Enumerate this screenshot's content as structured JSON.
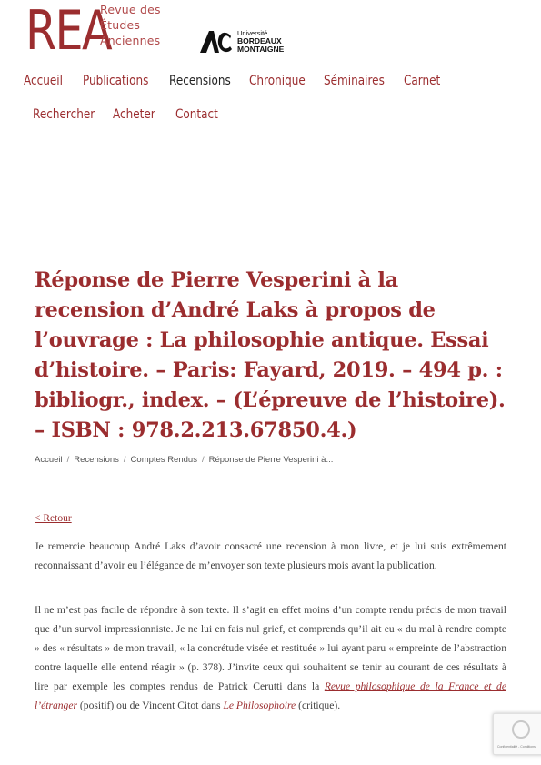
{
  "header": {
    "logo": {
      "main": "REA",
      "line1": "Revue des",
      "line2": "Études",
      "line3": "Anciennes"
    },
    "university": {
      "line1": "Université",
      "line2": "BORDEAUX",
      "line3": "MONTAIGNE"
    }
  },
  "nav": {
    "row1": [
      "Accueil",
      "Publications",
      "Recensions",
      "Chronique",
      "Séminaires",
      "Carnet"
    ],
    "row2": [
      "Rechercher",
      "Acheter",
      "Contact"
    ],
    "active": "Recensions"
  },
  "article": {
    "title": "Réponse de Pierre Vesperini à la recension d’André Laks à propos de l’ouvrage : La philosophie antique. Essai d’histoire. – Paris: Fayard, 2019. – 494 p. : bibliogr., index. – (L’épreuve de l’histoire). – ISBN : 978.2.213.67850.4.)",
    "breadcrumb": [
      "Accueil",
      "Recensions",
      "Comptes Rendus",
      "Réponse de Pierre Vesperini à..."
    ],
    "back": "< Retour",
    "p1": "Je remercie beaucoup André Laks d’avoir consacré une recension à mon livre, et je lui suis extrêmement reconnaissant d’avoir eu l’élégance de m’envoyer son texte plusieurs mois avant la publication.",
    "p2_a": "Il ne m’est pas facile de répondre à son texte. Il s’agit en effet moins d’un compte rendu précis de mon travail que d’un survol impressionniste. Je ne lui en fais nul grief, et comprends qu’il ait eu « du mal à rendre compte » des « résultats » de mon travail, « la concrétude visée et restituée » lui ayant paru « empreinte de l’abstraction contre laquelle elle entend réagir » (p. 378). J’invite ceux qui souhaitent se tenir au courant de ces résultats à lire par exemple les comptes rendus de Patrick Cerutti dans la ",
    "p2_link1": "Revue philosophique de la France et de l’étranger",
    "p2_b": " (positif) ou de Vincent Citot dans ",
    "p2_link2": "Le Philosophoire",
    "p2_c": " (critique)."
  },
  "recaptcha": {
    "text": "Confidentialité - Conditions"
  }
}
